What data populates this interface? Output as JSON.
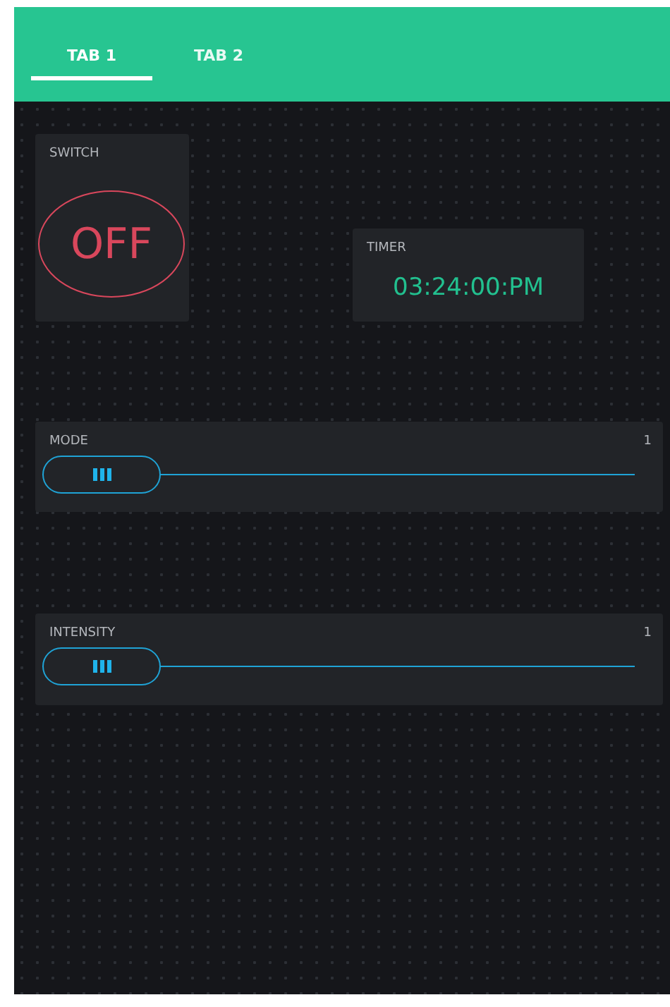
{
  "tabs": [
    {
      "label": "TAB 1",
      "selected": true
    },
    {
      "label": "TAB 2",
      "selected": false
    }
  ],
  "widgets": [
    {
      "kind": "switch",
      "label": "SWITCH",
      "value": "OFF",
      "on": false
    },
    {
      "kind": "timer",
      "label": "TIMER",
      "value": "03:24:00:PM"
    },
    {
      "kind": "slider",
      "label": "MODE",
      "reading": "1",
      "level": 0
    },
    {
      "kind": "slider",
      "label": "INTENSITY",
      "reading": "1",
      "level": 0
    }
  ]
}
